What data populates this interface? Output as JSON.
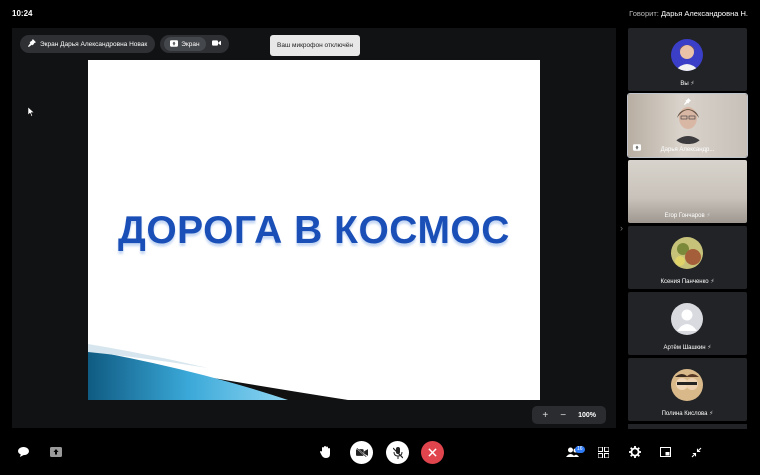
{
  "topbar": {
    "time": "10:24",
    "speaker_label": "Говорит:",
    "speaker_name": "Дарья Александровна Н."
  },
  "stage": {
    "screen_pill_label": "Экран Дарья Александровна Новак",
    "share_pill_label": "Экран",
    "toast": "Ваш микрофон отключён",
    "slide_title": "ДОРОГА В КОСМОС",
    "zoom_plus": "+",
    "zoom_minus": "−",
    "zoom_value": "100%"
  },
  "participants": [
    {
      "name": "Вы"
    },
    {
      "name": "Дарья Александр..."
    },
    {
      "name": "Егор Гончаров"
    },
    {
      "name": "Ксения Панченко"
    },
    {
      "name": "Артём Шашкин"
    },
    {
      "name": "Полина Кислова"
    }
  ],
  "toolbar": {
    "participants_count": "16"
  },
  "colors": {
    "end_call": "#e0454d",
    "title_blue": "#1a4fb8",
    "accent_badge": "#2f7bf5"
  }
}
